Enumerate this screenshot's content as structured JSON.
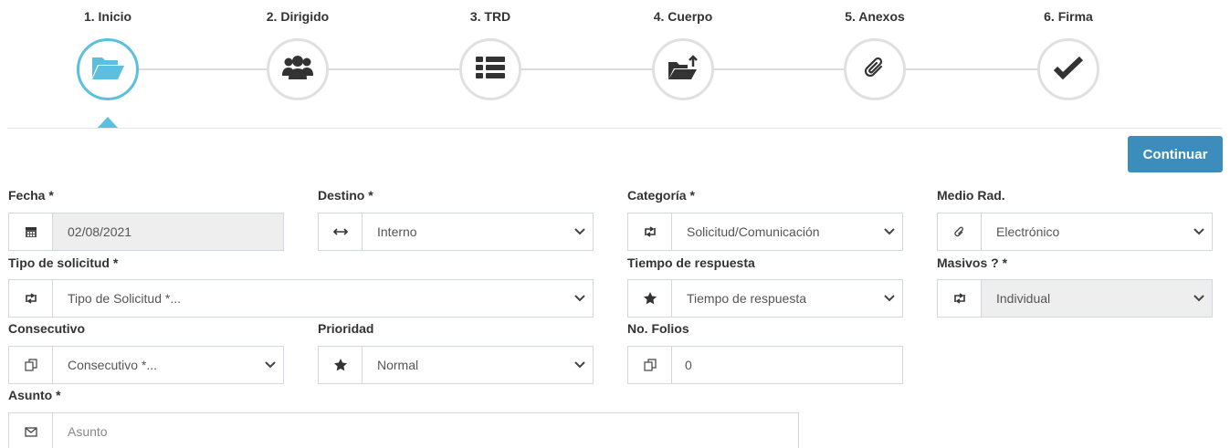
{
  "steps": [
    {
      "label": "1. Inicio",
      "icon": "folder-open-icon"
    },
    {
      "label": "2. Dirigido",
      "icon": "users-icon"
    },
    {
      "label": "3. TRD",
      "icon": "list-icon"
    },
    {
      "label": "4. Cuerpo",
      "icon": "folder-upload-icon"
    },
    {
      "label": "5. Anexos",
      "icon": "paperclip-icon"
    },
    {
      "label": "6. Firma",
      "icon": "check-icon"
    }
  ],
  "actions": {
    "continue_label": "Continuar"
  },
  "form": {
    "fecha": {
      "label": "Fecha *",
      "value": "02/08/2021",
      "icon": "calendar-icon"
    },
    "destino": {
      "label": "Destino *",
      "value": "Interno",
      "icon": "arrows-horizontal-icon"
    },
    "categoria": {
      "label": "Categoría *",
      "value": "Solicitud/Comunicación",
      "icon": "retweet-icon"
    },
    "medio": {
      "label": "Medio Rad.",
      "value": "Electrónico",
      "icon": "paperclip-icon"
    },
    "tipo_solicitud": {
      "label": "Tipo de solicitud *",
      "value": "Tipo de Solicitud *...",
      "icon": "retweet-icon"
    },
    "tiempo_respuesta": {
      "label": "Tiempo de respuesta",
      "value": "Tiempo de respuesta",
      "icon": "star-icon"
    },
    "masivos": {
      "label": "Masivos ? *",
      "value": "Individual",
      "icon": "retweet-icon"
    },
    "consecutivo": {
      "label": "Consecutivo",
      "value": "Consecutivo *...",
      "icon": "copy-icon"
    },
    "prioridad": {
      "label": "Prioridad",
      "value": "Normal",
      "icon": "star-icon"
    },
    "folios": {
      "label": "No. Folios",
      "value": "0",
      "icon": "copy-icon"
    },
    "asunto": {
      "label": "Asunto *",
      "placeholder": "Asunto",
      "icon": "envelope-icon"
    }
  },
  "colors": {
    "accent": "#3c8dbc",
    "active_step": "#5bbfe0",
    "icon": "#333333"
  }
}
